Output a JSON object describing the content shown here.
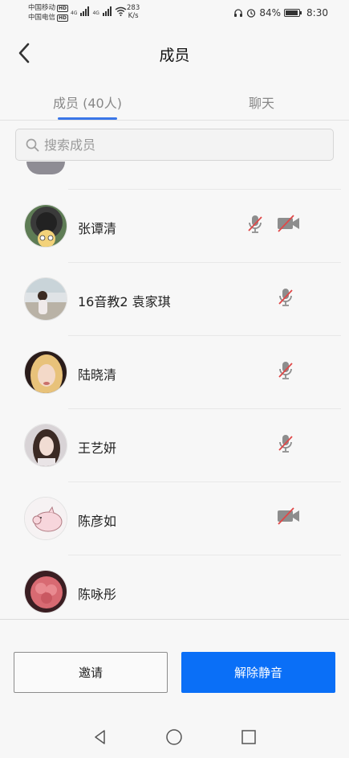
{
  "status_bar": {
    "carrier1": "中国移动",
    "carrier2": "中国电信",
    "hd": "HD",
    "net1": "4G",
    "net2": "4G",
    "speed_value": "283",
    "speed_unit": "K/s",
    "battery": "84%",
    "time": "8:30"
  },
  "header": {
    "title": "成员"
  },
  "tabs": [
    {
      "label": "成员 (40人)",
      "active": true
    },
    {
      "label": "聊天",
      "active": false
    }
  ],
  "search": {
    "placeholder": "搜索成员"
  },
  "members": [
    {
      "name": "张谭清",
      "mic_muted": true,
      "camera_off": true
    },
    {
      "name": "16音教2 袁家琪",
      "mic_muted": true,
      "camera_off": false
    },
    {
      "name": "陆晓清",
      "mic_muted": true,
      "camera_off": false
    },
    {
      "name": "王艺妍",
      "mic_muted": true,
      "camera_off": false
    },
    {
      "name": "陈彦如",
      "mic_muted": false,
      "camera_off": true
    },
    {
      "name": "陈咏彤",
      "mic_muted": false,
      "camera_off": false
    }
  ],
  "footer": {
    "invite_label": "邀请",
    "unmute_label": "解除静音"
  },
  "colors": {
    "accent": "#0a6ff7",
    "tab_indicator": "#3a76e8",
    "muted_slash": "#e04848"
  }
}
